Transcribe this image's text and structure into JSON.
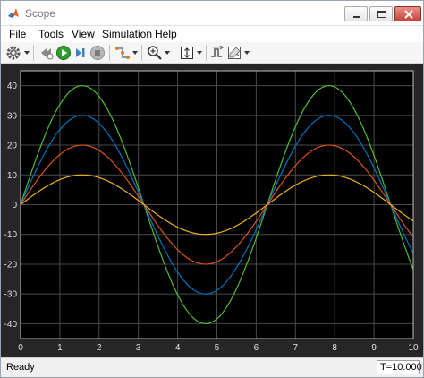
{
  "window": {
    "title": "Scope"
  },
  "menu": {
    "items": [
      "File",
      "Tools",
      "View",
      "Simulation",
      "Help"
    ]
  },
  "toolbar": {
    "icons": [
      "settings-icon",
      "step-back-icon",
      "run-icon",
      "step-forward-icon",
      "stop-icon",
      "highlight-signal-icon",
      "zoom-in-icon",
      "scale-axes-icon",
      "triggers-icon",
      "cursor-measurements-icon"
    ]
  },
  "status": {
    "text": "Ready",
    "time": "T=10.000"
  },
  "chart_data": {
    "type": "line",
    "title": "",
    "xlabel": "",
    "ylabel": "",
    "xlim": [
      0,
      10
    ],
    "ylim": [
      -45,
      45
    ],
    "xticks": [
      0,
      1,
      2,
      3,
      4,
      5,
      6,
      7,
      8,
      9,
      10
    ],
    "yticks": [
      40,
      30,
      20,
      10,
      0,
      -10,
      -20,
      -30,
      -40
    ],
    "grid": true,
    "background": "#000000",
    "series": [
      {
        "amplitude": 40,
        "color": "#4dbd33",
        "x": [
          0,
          0.5,
          1,
          1.5708,
          2,
          2.5,
          3,
          3.1416,
          3.5,
          4,
          4.7124,
          5,
          5.5,
          6,
          6.2832,
          6.5,
          7,
          7.854,
          8.5,
          9,
          9.4248,
          10
        ],
        "values": [
          0,
          19.2,
          33.7,
          40,
          36.4,
          23.9,
          5.6,
          0,
          -14.0,
          -30.3,
          -40,
          -38.4,
          -28.3,
          -11.2,
          0,
          8.6,
          26.3,
          40,
          32.0,
          16.5,
          0,
          -21.8
        ]
      },
      {
        "amplitude": 30,
        "color": "#0072bd",
        "x": [
          0,
          0.5,
          1,
          1.5708,
          2,
          2.5,
          3,
          3.1416,
          3.5,
          4,
          4.7124,
          5,
          5.5,
          6,
          6.2832,
          6.5,
          7,
          7.854,
          8.5,
          9,
          9.4248,
          10
        ],
        "values": [
          0,
          14.4,
          25.2,
          30,
          27.3,
          18.0,
          4.2,
          0,
          -10.5,
          -22.7,
          -30,
          -28.8,
          -21.2,
          -8.4,
          0,
          6.5,
          19.7,
          30,
          24.0,
          12.4,
          0,
          -16.3
        ]
      },
      {
        "amplitude": 20,
        "color": "#d95319",
        "x": [
          0,
          0.5,
          1,
          1.5708,
          2,
          2.5,
          3,
          3.1416,
          3.5,
          4,
          4.7124,
          5,
          5.5,
          6,
          6.2832,
          6.5,
          7,
          7.854,
          8.5,
          9,
          9.4248,
          10
        ],
        "values": [
          0,
          9.6,
          16.8,
          20,
          18.2,
          12.0,
          2.8,
          0,
          -7.0,
          -15.1,
          -20,
          -19.2,
          -14.1,
          -5.6,
          0,
          4.3,
          13.1,
          20,
          16.0,
          8.2,
          0,
          -10.9
        ]
      },
      {
        "amplitude": 10,
        "color": "#edb120",
        "x": [
          0,
          0.5,
          1,
          1.5708,
          2,
          2.5,
          3,
          3.1416,
          3.5,
          4,
          4.7124,
          5,
          5.5,
          6,
          6.2832,
          6.5,
          7,
          7.854,
          8.5,
          9,
          9.4248,
          10
        ],
        "values": [
          0,
          4.8,
          8.4,
          10,
          9.1,
          6.0,
          1.4,
          0,
          -3.5,
          -7.6,
          -10,
          -9.6,
          -7.1,
          -2.8,
          0,
          2.2,
          6.6,
          10,
          8.0,
          4.1,
          0,
          -5.4
        ]
      }
    ]
  }
}
